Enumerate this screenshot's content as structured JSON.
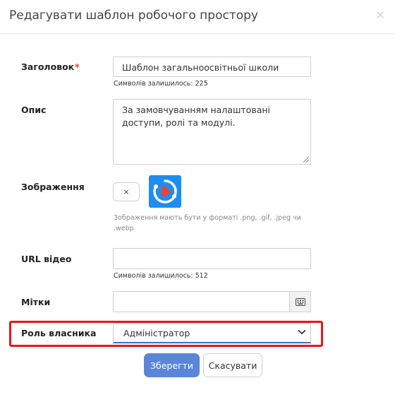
{
  "modal": {
    "title": "Редагувати шаблон робочого простору",
    "close_glyph": "×"
  },
  "form": {
    "title_field": {
      "label": "Заголовок",
      "required_mark": "*",
      "value": "Шаблон загальноосвітньої школи",
      "hint": "Символів залишилось: 225"
    },
    "description_field": {
      "label": "Опис",
      "value": "За замовчуванням налаштовані доступи, ролі та модулі."
    },
    "image_field": {
      "label": "Зображення",
      "remove_glyph": "×",
      "thumbnail_icon": "play-logo-icon",
      "hint": "Зображення мають бути у форматі .png, .gif, .jpeg чи .webp"
    },
    "video_url_field": {
      "label": "URL відео",
      "value": "",
      "hint": "Символів залишилось: 512"
    },
    "tags_field": {
      "label": "Мітки",
      "value": "",
      "button_icon": "keyboard-icon"
    },
    "owner_role_field": {
      "label": "Роль власника",
      "selected": "Адміністратор",
      "highlight_color": "#e51818"
    }
  },
  "actions": {
    "save_label": "Зберегти",
    "cancel_label": "Скасувати"
  },
  "colors": {
    "primary": "#5b86d8",
    "required": "#e0412c",
    "highlight": "#e51818",
    "thumbnail_bg": "#1f8cf2",
    "thumbnail_play": "#e8442f"
  }
}
